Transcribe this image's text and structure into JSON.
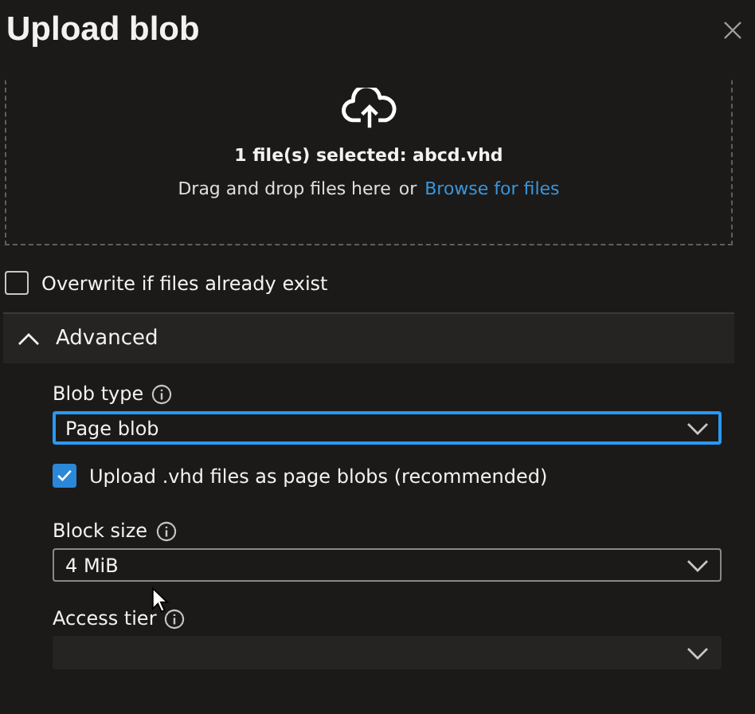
{
  "panel": {
    "title": "Upload blob"
  },
  "dropzone": {
    "status": "1 file(s) selected: abcd.vhd",
    "hint": "Drag and drop files here",
    "separator": "or",
    "link": "Browse for files"
  },
  "overwrite": {
    "label": "Overwrite if files already exist",
    "checked": false
  },
  "advanced": {
    "label": "Advanced",
    "expanded": true,
    "fields": [
      {
        "kind": "select",
        "label": "Blob type",
        "value": "Page blob",
        "focused": true,
        "disabled": false
      },
      {
        "kind": "checkbox",
        "label": "Upload .vhd files as page blobs (recommended)",
        "checked": true
      },
      {
        "kind": "select",
        "label": "Block size",
        "value": "4 MiB",
        "focused": false,
        "disabled": false
      },
      {
        "kind": "select",
        "label": "Access tier",
        "focused": false,
        "disabled": true
      }
    ]
  }
}
